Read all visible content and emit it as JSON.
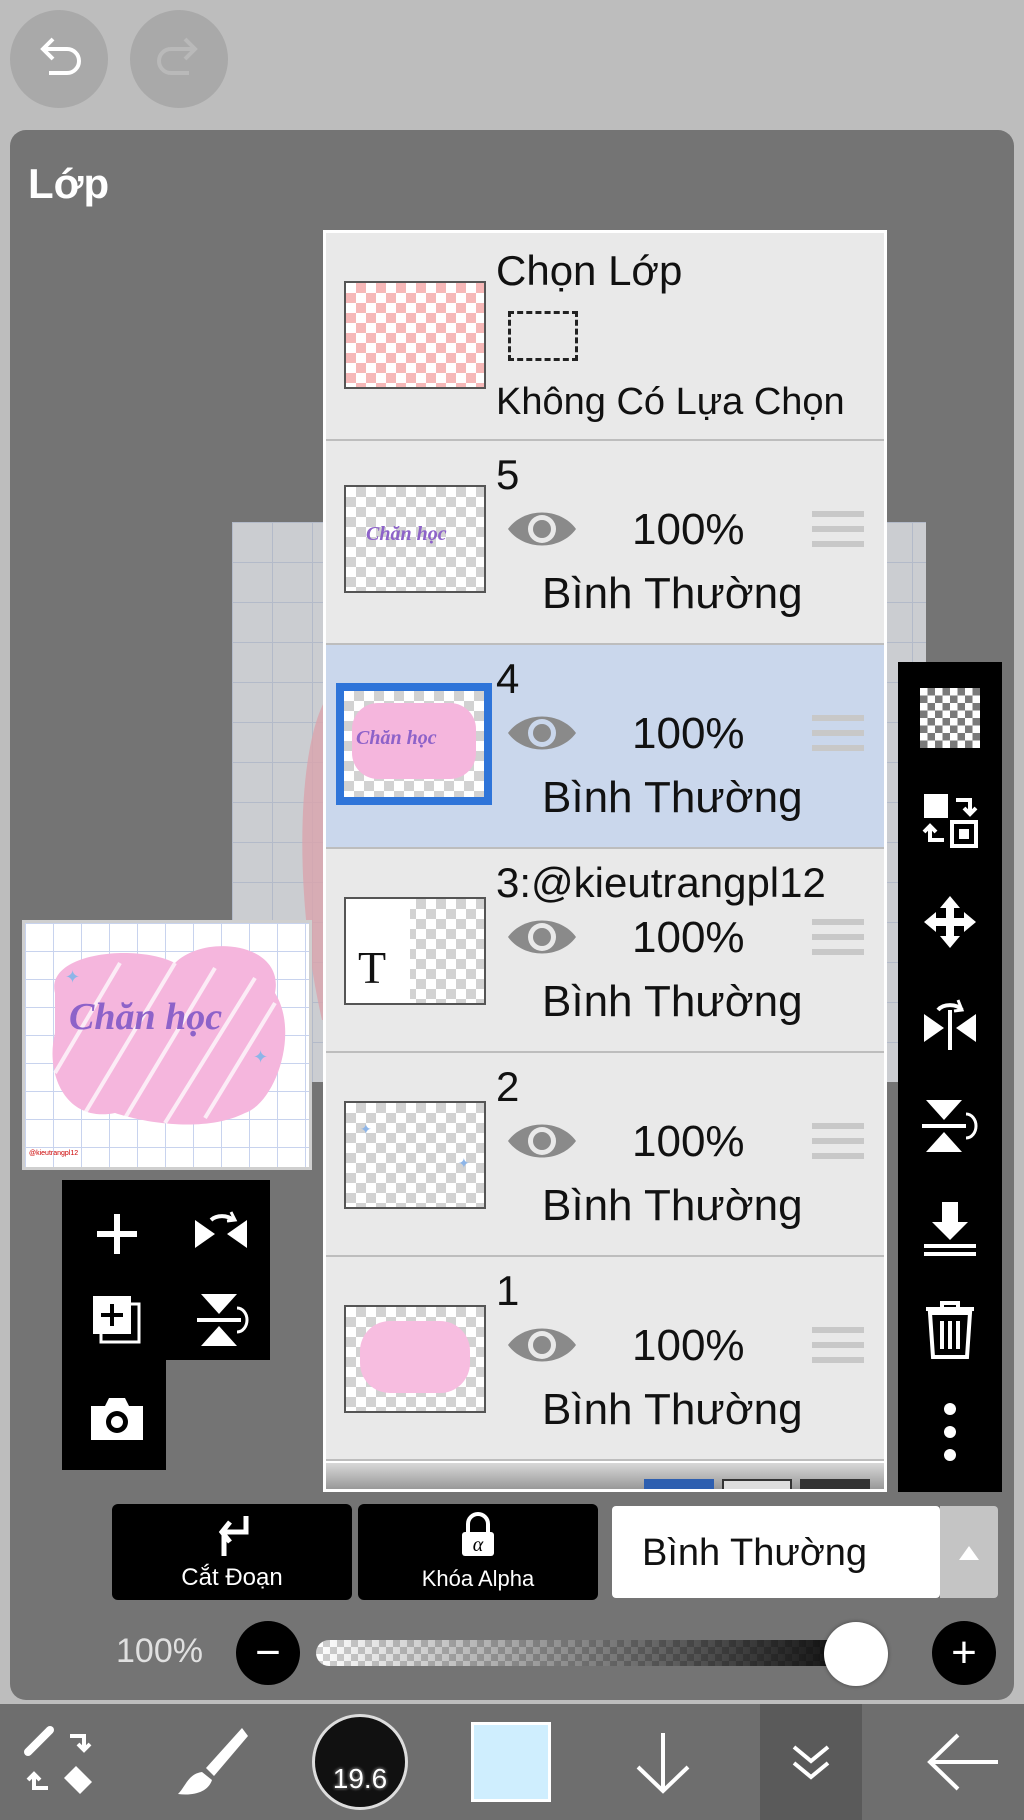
{
  "top": {
    "undo_icon": "undo-icon",
    "redo_icon": "redo-icon"
  },
  "panel": {
    "title": "Lớp"
  },
  "selection_layer": {
    "name": "Chọn Lớp",
    "status": "Không Có Lựa Chọn"
  },
  "layers": [
    {
      "name": "5",
      "opacity": "100%",
      "mode": "Bình Thường"
    },
    {
      "name": "4",
      "opacity": "100%",
      "mode": "Bình Thường",
      "selected": true
    },
    {
      "name": "3:@kieutrangpl12",
      "opacity": "100%",
      "mode": "Bình Thường"
    },
    {
      "name": "2",
      "opacity": "100%",
      "mode": "Bình Thường"
    },
    {
      "name": "1",
      "opacity": "100%",
      "mode": "Bình Thường"
    }
  ],
  "preview": {
    "text": "Chăn học",
    "watermark": "@kieutrangpl12"
  },
  "text_layer_glyph": "T",
  "actions": {
    "clip_label": "Cắt Đoạn",
    "alpha_lock_label": "Khóa Alpha",
    "blend_mode": "Bình Thường"
  },
  "opacity": {
    "value_label": "100%",
    "value": 1.0,
    "minus": "−",
    "plus": "+"
  },
  "brush": {
    "size": "19.6"
  },
  "colors": {
    "current_color": "#cfeefe",
    "selection": "#2e74d9",
    "selected_row": "#cad7ec"
  },
  "left_tools": [
    "add-layer-icon",
    "flip-horizontal-icon",
    "copy-layer-icon",
    "flip-vertical-icon",
    "camera-icon"
  ],
  "right_tools": [
    "transparency-icon",
    "swap-icon",
    "move-icon",
    "flip-horizontal-icon",
    "flip-vertical-icon",
    "merge-down-icon",
    "trash-icon",
    "more-icon"
  ],
  "bottom_tools": [
    "transform-eraser-icon",
    "brush-icon",
    "brush-size-icon",
    "color-swatch",
    "arrow-down-icon",
    "double-chevron-icon",
    "back-arrow-icon"
  ]
}
